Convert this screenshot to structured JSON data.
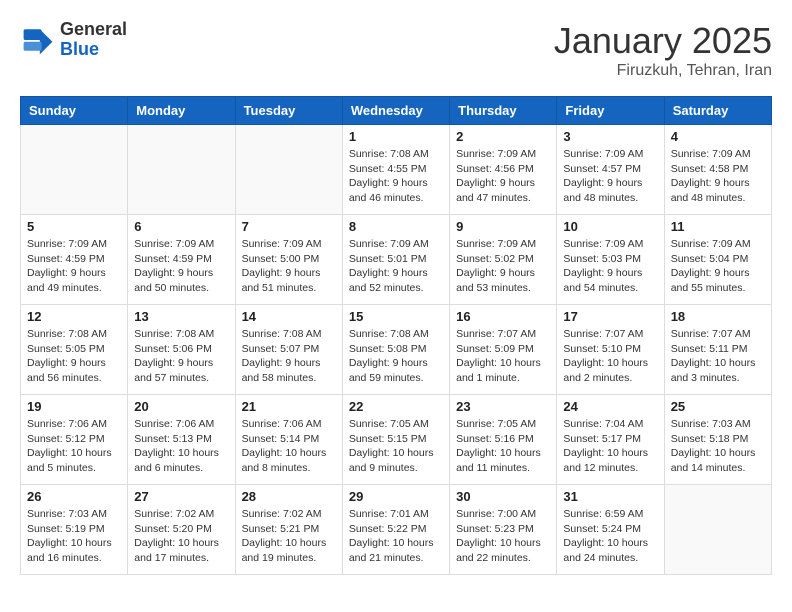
{
  "header": {
    "logo_line1": "General",
    "logo_line2": "Blue",
    "month": "January 2025",
    "location": "Firuzkuh, Tehran, Iran"
  },
  "days_of_week": [
    "Sunday",
    "Monday",
    "Tuesday",
    "Wednesday",
    "Thursday",
    "Friday",
    "Saturday"
  ],
  "weeks": [
    [
      {
        "day": "",
        "info": ""
      },
      {
        "day": "",
        "info": ""
      },
      {
        "day": "",
        "info": ""
      },
      {
        "day": "1",
        "info": "Sunrise: 7:08 AM\nSunset: 4:55 PM\nDaylight: 9 hours\nand 46 minutes."
      },
      {
        "day": "2",
        "info": "Sunrise: 7:09 AM\nSunset: 4:56 PM\nDaylight: 9 hours\nand 47 minutes."
      },
      {
        "day": "3",
        "info": "Sunrise: 7:09 AM\nSunset: 4:57 PM\nDaylight: 9 hours\nand 48 minutes."
      },
      {
        "day": "4",
        "info": "Sunrise: 7:09 AM\nSunset: 4:58 PM\nDaylight: 9 hours\nand 48 minutes."
      }
    ],
    [
      {
        "day": "5",
        "info": "Sunrise: 7:09 AM\nSunset: 4:59 PM\nDaylight: 9 hours\nand 49 minutes."
      },
      {
        "day": "6",
        "info": "Sunrise: 7:09 AM\nSunset: 4:59 PM\nDaylight: 9 hours\nand 50 minutes."
      },
      {
        "day": "7",
        "info": "Sunrise: 7:09 AM\nSunset: 5:00 PM\nDaylight: 9 hours\nand 51 minutes."
      },
      {
        "day": "8",
        "info": "Sunrise: 7:09 AM\nSunset: 5:01 PM\nDaylight: 9 hours\nand 52 minutes."
      },
      {
        "day": "9",
        "info": "Sunrise: 7:09 AM\nSunset: 5:02 PM\nDaylight: 9 hours\nand 53 minutes."
      },
      {
        "day": "10",
        "info": "Sunrise: 7:09 AM\nSunset: 5:03 PM\nDaylight: 9 hours\nand 54 minutes."
      },
      {
        "day": "11",
        "info": "Sunrise: 7:09 AM\nSunset: 5:04 PM\nDaylight: 9 hours\nand 55 minutes."
      }
    ],
    [
      {
        "day": "12",
        "info": "Sunrise: 7:08 AM\nSunset: 5:05 PM\nDaylight: 9 hours\nand 56 minutes."
      },
      {
        "day": "13",
        "info": "Sunrise: 7:08 AM\nSunset: 5:06 PM\nDaylight: 9 hours\nand 57 minutes."
      },
      {
        "day": "14",
        "info": "Sunrise: 7:08 AM\nSunset: 5:07 PM\nDaylight: 9 hours\nand 58 minutes."
      },
      {
        "day": "15",
        "info": "Sunrise: 7:08 AM\nSunset: 5:08 PM\nDaylight: 9 hours\nand 59 minutes."
      },
      {
        "day": "16",
        "info": "Sunrise: 7:07 AM\nSunset: 5:09 PM\nDaylight: 10 hours\nand 1 minute."
      },
      {
        "day": "17",
        "info": "Sunrise: 7:07 AM\nSunset: 5:10 PM\nDaylight: 10 hours\nand 2 minutes."
      },
      {
        "day": "18",
        "info": "Sunrise: 7:07 AM\nSunset: 5:11 PM\nDaylight: 10 hours\nand 3 minutes."
      }
    ],
    [
      {
        "day": "19",
        "info": "Sunrise: 7:06 AM\nSunset: 5:12 PM\nDaylight: 10 hours\nand 5 minutes."
      },
      {
        "day": "20",
        "info": "Sunrise: 7:06 AM\nSunset: 5:13 PM\nDaylight: 10 hours\nand 6 minutes."
      },
      {
        "day": "21",
        "info": "Sunrise: 7:06 AM\nSunset: 5:14 PM\nDaylight: 10 hours\nand 8 minutes."
      },
      {
        "day": "22",
        "info": "Sunrise: 7:05 AM\nSunset: 5:15 PM\nDaylight: 10 hours\nand 9 minutes."
      },
      {
        "day": "23",
        "info": "Sunrise: 7:05 AM\nSunset: 5:16 PM\nDaylight: 10 hours\nand 11 minutes."
      },
      {
        "day": "24",
        "info": "Sunrise: 7:04 AM\nSunset: 5:17 PM\nDaylight: 10 hours\nand 12 minutes."
      },
      {
        "day": "25",
        "info": "Sunrise: 7:03 AM\nSunset: 5:18 PM\nDaylight: 10 hours\nand 14 minutes."
      }
    ],
    [
      {
        "day": "26",
        "info": "Sunrise: 7:03 AM\nSunset: 5:19 PM\nDaylight: 10 hours\nand 16 minutes."
      },
      {
        "day": "27",
        "info": "Sunrise: 7:02 AM\nSunset: 5:20 PM\nDaylight: 10 hours\nand 17 minutes."
      },
      {
        "day": "28",
        "info": "Sunrise: 7:02 AM\nSunset: 5:21 PM\nDaylight: 10 hours\nand 19 minutes."
      },
      {
        "day": "29",
        "info": "Sunrise: 7:01 AM\nSunset: 5:22 PM\nDaylight: 10 hours\nand 21 minutes."
      },
      {
        "day": "30",
        "info": "Sunrise: 7:00 AM\nSunset: 5:23 PM\nDaylight: 10 hours\nand 22 minutes."
      },
      {
        "day": "31",
        "info": "Sunrise: 6:59 AM\nSunset: 5:24 PM\nDaylight: 10 hours\nand 24 minutes."
      },
      {
        "day": "",
        "info": ""
      }
    ]
  ]
}
